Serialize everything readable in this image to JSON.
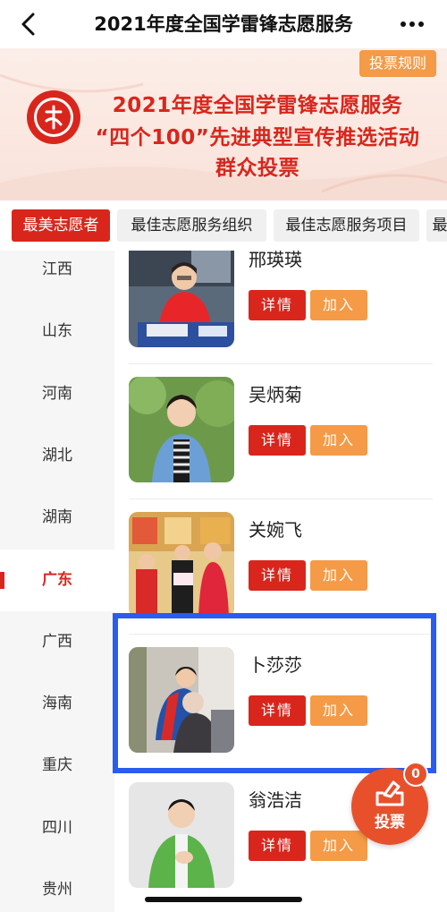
{
  "nav": {
    "title": "2021年度全国学雷锋志愿服务"
  },
  "banner": {
    "rules_label": "投票规则",
    "line1": "2021年度全国学雷锋志愿服务",
    "line2": "“四个100”先进典型宣传推选活动",
    "line3": "群众投票"
  },
  "tabs": [
    {
      "label": "最美志愿者",
      "active": true
    },
    {
      "label": "最佳志愿服务组织",
      "active": false
    },
    {
      "label": "最佳志愿服务项目",
      "active": false
    },
    {
      "label": "最",
      "active": false
    }
  ],
  "provinces": [
    {
      "label": "江西",
      "active": false
    },
    {
      "label": "山东",
      "active": false
    },
    {
      "label": "河南",
      "active": false
    },
    {
      "label": "湖北",
      "active": false
    },
    {
      "label": "湖南",
      "active": false
    },
    {
      "label": "广东",
      "active": true
    },
    {
      "label": "广西",
      "active": false
    },
    {
      "label": "海南",
      "active": false
    },
    {
      "label": "重庆",
      "active": false
    },
    {
      "label": "四川",
      "active": false
    },
    {
      "label": "贵州",
      "active": false
    }
  ],
  "volunteers": [
    {
      "name": "邢瑛瑛",
      "detail_label": "详情",
      "join_label": "加入",
      "photo_caption": "邢瑛瑛"
    },
    {
      "name": "吴炳菊",
      "detail_label": "详情",
      "join_label": "加入"
    },
    {
      "name": "关婉飞",
      "detail_label": "详情",
      "join_label": "加入"
    },
    {
      "name": "卜莎莎",
      "detail_label": "详情",
      "join_label": "加入"
    },
    {
      "name": "翁浩洁",
      "detail_label": "详情",
      "join_label": "加入"
    }
  ],
  "vote_fab": {
    "label": "投票",
    "badge": "0"
  },
  "colors": {
    "brand_red": "#d9261c",
    "orange": "#f59a46",
    "highlight_blue": "#2a5cf0"
  },
  "icons": [
    "back-arrow-icon",
    "more-dots-icon",
    "vote-ballot-icon"
  ]
}
